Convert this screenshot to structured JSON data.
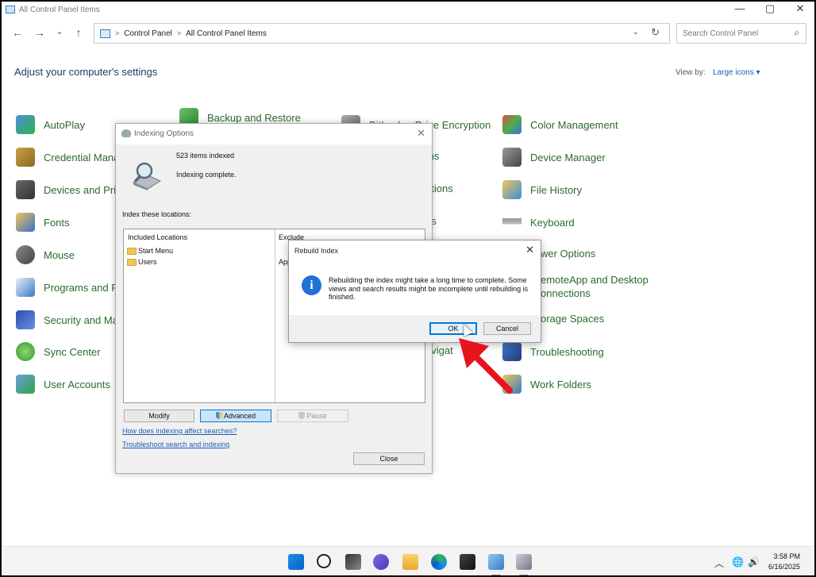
{
  "window": {
    "title": "All Control Panel Items",
    "controls": {
      "minimize": "—",
      "maximize": "▢",
      "close": "✕"
    }
  },
  "nav": {
    "back": "←",
    "forward": "→",
    "recent": "⌄",
    "up": "↑",
    "breadcrumb": [
      "Control Panel",
      "All Control Panel Items"
    ],
    "separator": ">",
    "dropdown": "⌄",
    "refresh": "↻",
    "search_placeholder": "Search Control Panel",
    "search_icon": "⌕"
  },
  "header": {
    "title": "Adjust your computer's settings",
    "view_by_label": "View by:",
    "view_by_value": "Large icons ▾"
  },
  "items": {
    "col1": [
      "AutoPlay",
      "Credential Mana",
      "Devices and Prin",
      "Fonts",
      "Mouse",
      "Programs and F",
      "Security and Ma",
      "Sync Center",
      "User Accounts"
    ],
    "col2": [
      "Backup and Restore"
    ],
    "col3": [
      "BitLocker Drive Encryption",
      "ms",
      "ptions",
      "ns",
      "avigat",
      "s"
    ],
    "col4": [
      "Color Management",
      "Device Manager",
      "File History",
      "Keyboard",
      "wer Options",
      "emoteApp and Desktop\nonnections",
      "orage Spaces",
      "Troubleshooting",
      "Work Folders"
    ]
  },
  "indexing": {
    "title": "Indexing Options",
    "close": "✕",
    "count": "523 items indexed",
    "status": "Indexing complete.",
    "locations_label": "Index these locations:",
    "col_included": "Included Locations",
    "col_exclude": "Exclude",
    "locations": [
      "Start Menu",
      "Users"
    ],
    "exclude_value": "App",
    "buttons": {
      "modify": "Modify",
      "advanced": "Advanced",
      "pause": "Pause",
      "close": "Close"
    },
    "links": [
      "How does indexing affect searches?",
      "Troubleshoot search and indexing"
    ]
  },
  "rebuild": {
    "title": "Rebuild Index",
    "close": "✕",
    "message": "Rebuilding the index might take a long time to complete. Some views and search results might be incomplete until rebuilding is finished.",
    "ok": "OK",
    "cancel": "Cancel"
  },
  "taskbar": {
    "tray_arrow": "︿",
    "time": "3:58 PM",
    "date": "6/16/2025"
  },
  "colors": {
    "link_green": "#2b6a2f",
    "accent_blue": "#0078d7",
    "arrow_red": "#e8141b"
  }
}
